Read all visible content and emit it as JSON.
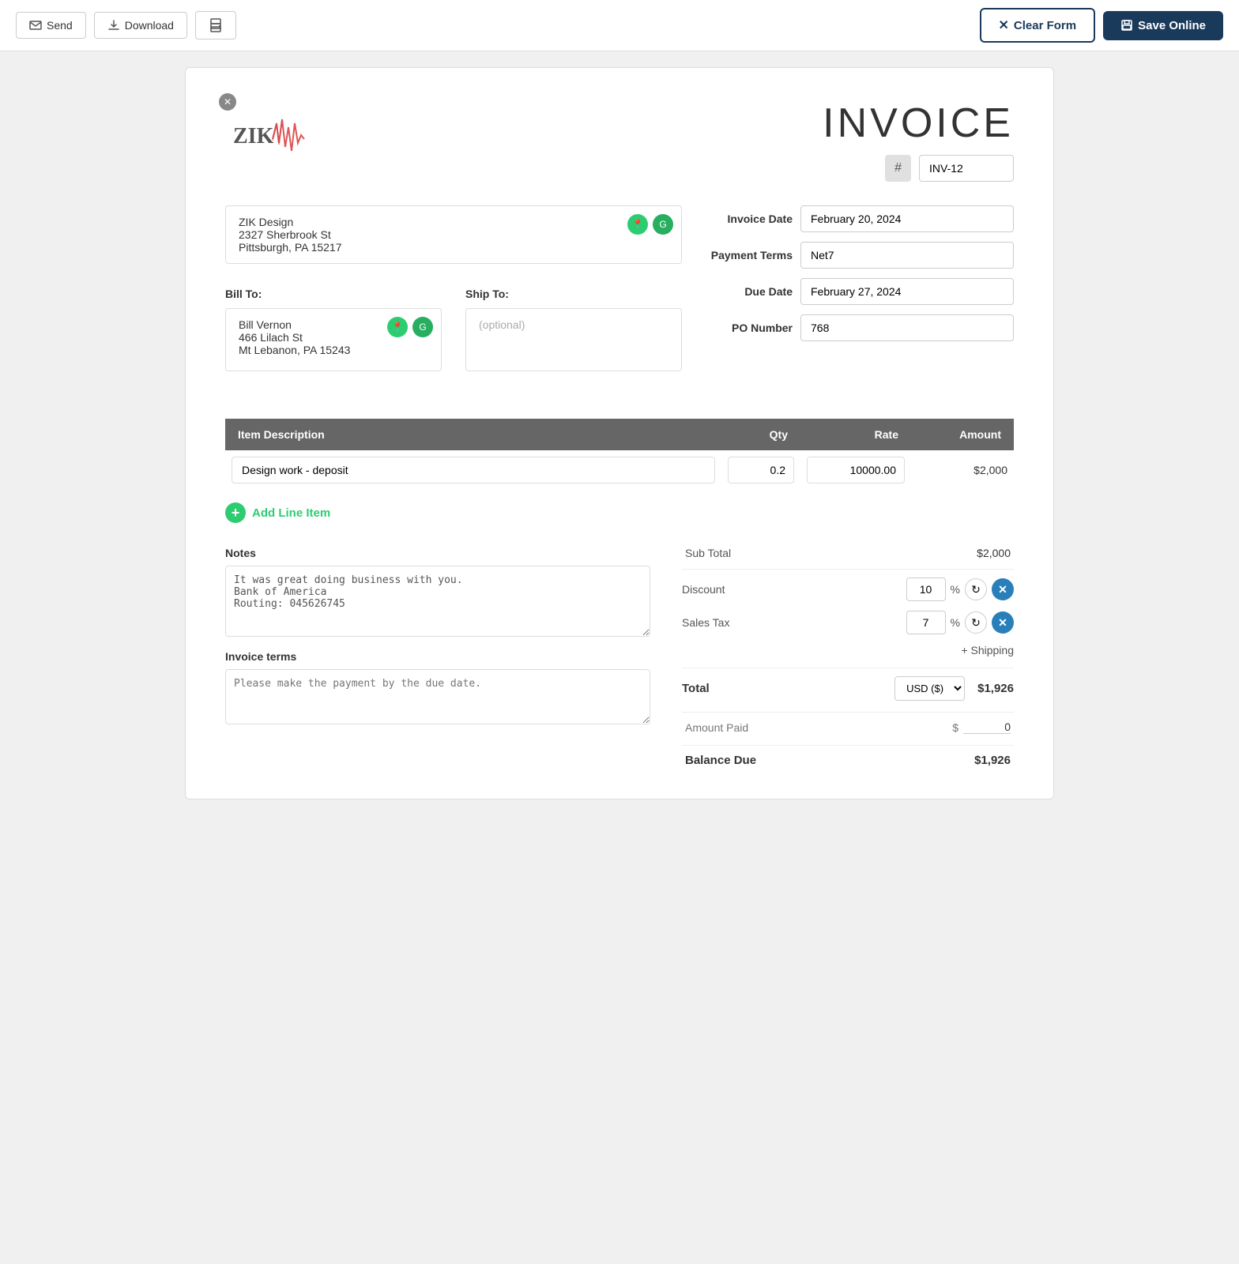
{
  "toolbar": {
    "send_label": "Send",
    "download_label": "Download",
    "print_label": "",
    "clear_form_label": "Clear Form",
    "save_online_label": "Save Online"
  },
  "invoice": {
    "title": "INVOICE",
    "number": "INV-12",
    "number_placeholder": "INV-12",
    "date_label": "Invoice Date",
    "date_value": "February 20, 2024",
    "payment_terms_label": "Payment Terms",
    "payment_terms_value": "Net7",
    "due_date_label": "Due Date",
    "due_date_value": "February 27, 2024",
    "po_number_label": "PO Number",
    "po_number_value": "768"
  },
  "from": {
    "company": "ZIK Design",
    "address1": "2327 Sherbrook St",
    "address2": "Pittsburgh, PA 15217"
  },
  "bill_to": {
    "label": "Bill To:",
    "name": "Bill Vernon",
    "address1": "466 Lilach St",
    "address2": "Mt Lebanon, PA 15243"
  },
  "ship_to": {
    "label": "Ship To:",
    "placeholder": "(optional)"
  },
  "items": {
    "col_description": "Item Description",
    "col_qty": "Qty",
    "col_rate": "Rate",
    "col_amount": "Amount",
    "rows": [
      {
        "description": "Design work - deposit",
        "qty": "0.2",
        "rate": "10000.00",
        "amount": "$2,000"
      }
    ],
    "add_line_label": "Add Line Item"
  },
  "notes": {
    "label": "Notes",
    "value": "It was great doing business with you.\nBank of America\nRouting: 045626745",
    "placeholder": ""
  },
  "terms": {
    "label": "Invoice terms",
    "placeholder": "Please make the payment by the due date."
  },
  "totals": {
    "subtotal_label": "Sub Total",
    "subtotal_value": "$2,000",
    "discount_label": "Discount",
    "discount_value": "10",
    "discount_pct": "%",
    "tax_label": "Sales Tax",
    "tax_value": "7",
    "tax_pct": "%",
    "shipping_label": "+ Shipping",
    "total_label": "Total",
    "currency_value": "USD ($)",
    "total_value": "$1,926",
    "amount_paid_label": "Amount Paid",
    "amount_paid_symbol": "$",
    "amount_paid_value": "0",
    "balance_due_label": "Balance Due",
    "balance_due_value": "$1,926"
  }
}
